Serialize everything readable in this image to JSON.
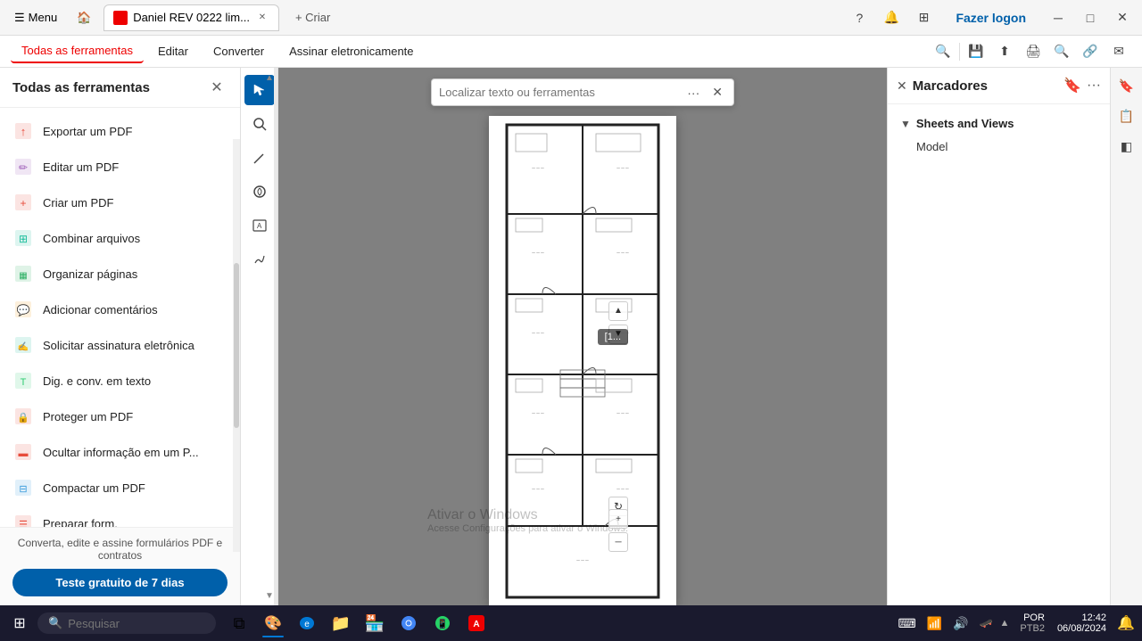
{
  "titlebar": {
    "menu_label": "Menu",
    "tab_title": "Daniel REV 0222 lim...",
    "new_tab_label": "+ Criar",
    "help_icon": "?",
    "bell_icon": "🔔",
    "apps_icon": "⊞",
    "login_label": "Fazer logon",
    "minimize_icon": "─",
    "maximize_icon": "□",
    "close_icon": "✕"
  },
  "menubar": {
    "items": [
      {
        "label": "Todas as ferramentas",
        "active": true
      },
      {
        "label": "Editar",
        "active": false
      },
      {
        "label": "Converter",
        "active": false
      },
      {
        "label": "Assinar eletronicamente",
        "active": false
      }
    ],
    "search_icon": "🔍",
    "save_icon": "💾",
    "upload_icon": "⬆",
    "print_icon": "🖨",
    "zoom_icon": "🔍",
    "link_icon": "🔗",
    "mail_icon": "✉"
  },
  "left_panel": {
    "title": "Todas as ferramentas",
    "close_icon": "✕",
    "tools": [
      {
        "label": "Exportar um PDF",
        "icon": "📤"
      },
      {
        "label": "Editar um PDF",
        "icon": "✏️"
      },
      {
        "label": "Criar um PDF",
        "icon": "📄"
      },
      {
        "label": "Combinar arquivos",
        "icon": "🗂️"
      },
      {
        "label": "Organizar páginas",
        "icon": "📋"
      },
      {
        "label": "Adicionar comentários",
        "icon": "💬"
      },
      {
        "label": "Solicitar assinatura eletrônica",
        "icon": "✍️"
      },
      {
        "label": "Dig. e conv. em texto",
        "icon": "🔤"
      },
      {
        "label": "Proteger um PDF",
        "icon": "🔒"
      },
      {
        "label": "Ocultar informação em um P...",
        "icon": "🗑️"
      },
      {
        "label": "Compactar um PDF",
        "icon": "📦"
      },
      {
        "label": "Preparar form.",
        "icon": "📝"
      }
    ],
    "footer_text": "Converta, edite e assine formulários PDF e contratos",
    "trial_button": "Teste gratuito de 7 dias"
  },
  "vertical_toolbar": {
    "tools": [
      {
        "name": "select-tool",
        "icon": "↖",
        "active": true
      },
      {
        "name": "zoom-tool",
        "icon": "🔍",
        "active": false
      },
      {
        "name": "pen-tool",
        "icon": "✏️",
        "active": false
      },
      {
        "name": "annotation-tool",
        "icon": "🔗",
        "active": false
      },
      {
        "name": "text-tool",
        "icon": "T",
        "active": false
      },
      {
        "name": "signature-tool",
        "icon": "✒️",
        "active": false
      }
    ]
  },
  "search_bar": {
    "placeholder": "Localizar texto ou ferramentas",
    "more_label": "···",
    "close_label": "✕"
  },
  "right_panel": {
    "title": "Marcadores",
    "close_icon": "✕",
    "more_icon": "···",
    "bookmarks": [
      {
        "label": "Sheets and Views",
        "expanded": true,
        "children": [
          {
            "label": "Model"
          }
        ]
      }
    ]
  },
  "right_icon_strip": {
    "icons": [
      {
        "name": "bookmark-icon",
        "symbol": "🔖",
        "active": false
      },
      {
        "name": "copy-icon",
        "symbol": "📋",
        "active": false
      },
      {
        "name": "layers-icon",
        "symbol": "◧",
        "active": false
      }
    ]
  },
  "page_controls": {
    "badge": "[1...",
    "current_page": "1",
    "up_icon": "▲",
    "down_icon": "▼",
    "refresh_icon": "↻",
    "zoom_in_icon": "+",
    "zoom_out_icon": "─"
  },
  "windows_watermark": {
    "title": "Ativar o Windows",
    "subtitle": "Acesse Configurações para ativar o Windows."
  },
  "taskbar": {
    "start_icon": "⊞",
    "search_placeholder": "Pesquisar",
    "apps": [
      {
        "name": "task-view",
        "symbol": "⧉"
      },
      {
        "name": "paint-app",
        "symbol": "🎨"
      },
      {
        "name": "edge-browser",
        "symbol": "e"
      },
      {
        "name": "file-explorer",
        "symbol": "📁"
      },
      {
        "name": "store-app",
        "symbol": "🏪"
      },
      {
        "name": "chrome-browser",
        "symbol": "●"
      },
      {
        "name": "whatsapp-app",
        "symbol": "📱"
      },
      {
        "name": "acrobat-app",
        "symbol": "A"
      }
    ],
    "tray_icons": [
      "⌨",
      "📶",
      "🔊"
    ],
    "language": "POR",
    "keyboard": "PTB2",
    "time": "12:42",
    "date": "06/08/2024",
    "notification_icon": "🔔"
  }
}
